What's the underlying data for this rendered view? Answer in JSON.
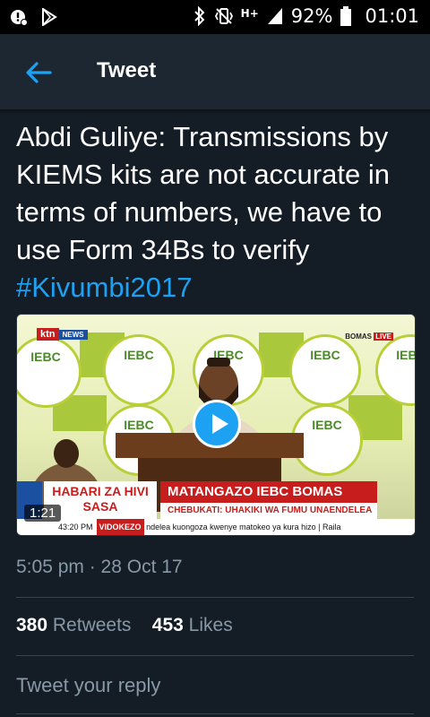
{
  "status_bar": {
    "battery": "92%",
    "time": "01:01",
    "network": "H+",
    "icons": [
      "notification-icon",
      "play-store-icon",
      "bluetooth-icon",
      "vibrate-icon",
      "signal-icon",
      "battery-icon"
    ]
  },
  "header": {
    "title": "Tweet",
    "back_icon": "back-arrow-icon"
  },
  "tweet": {
    "text": "Abdi Guliye: Transmissions by KIEMS kits are not accurate in terms of numbers, we have to use Form 34Bs to verify",
    "hashtag": "#Kivumbi2017",
    "timestamp": "5:05 pm · 28 Oct 17",
    "retweets_count": "380",
    "retweets_label": "Retweets",
    "likes_count": "453",
    "likes_label": "Likes"
  },
  "media": {
    "duration": "1:21",
    "channel_logo": "ktn",
    "channel_sub": "NEWS",
    "bomas_label": "BOMAS",
    "live_label": "LIVE",
    "banner_left": "HABARI ZA HIVI SASA",
    "banner_title": "MATANGAZO IEBC BOMAS",
    "banner_sub": "CHEBUKATI: UHAKIKI WA FUMU UNAENDELEA",
    "ticker_time": "43:20 PM",
    "ticker_tag": "VIDOKEZO",
    "ticker_text": "ndelea kuongoza kwenye matokeo ya kura hizo  |  Raila",
    "logo_text": "IEBC"
  },
  "reply": {
    "placeholder": "Tweet your reply"
  },
  "colors": {
    "background": "#141d26",
    "header": "#1c2732",
    "accent": "#1da1f2",
    "muted": "#8899a6"
  }
}
